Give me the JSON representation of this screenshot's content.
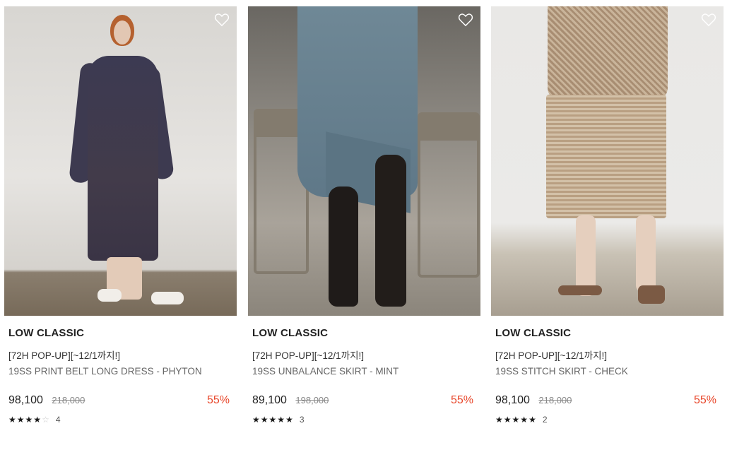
{
  "products": [
    {
      "brand": "LOW CLASSIC",
      "tagline": "[72H POP-UP][~12/1까지!]",
      "name": "19SS PRINT BELT LONG DRESS - PHYTON",
      "price": "98,100",
      "original_price": "218,000",
      "discount": "55%",
      "rating": 4,
      "review_count": "4"
    },
    {
      "brand": "LOW CLASSIC",
      "tagline": "[72H POP-UP][~12/1까지!]",
      "name": "19SS UNBALANCE SKIRT - MINT",
      "price": "89,100",
      "original_price": "198,000",
      "discount": "55%",
      "rating": 5,
      "review_count": "3"
    },
    {
      "brand": "LOW CLASSIC",
      "tagline": "[72H POP-UP][~12/1까지!]",
      "name": "19SS STITCH SKIRT - CHECK",
      "price": "98,100",
      "original_price": "218,000",
      "discount": "55%",
      "rating": 5,
      "review_count": "2"
    }
  ],
  "colors": {
    "discount": "#e8462a",
    "text": "#222222",
    "muted": "#888888"
  },
  "icons": {
    "wishlist": "heart-outline-icon",
    "star": "star-icon"
  }
}
